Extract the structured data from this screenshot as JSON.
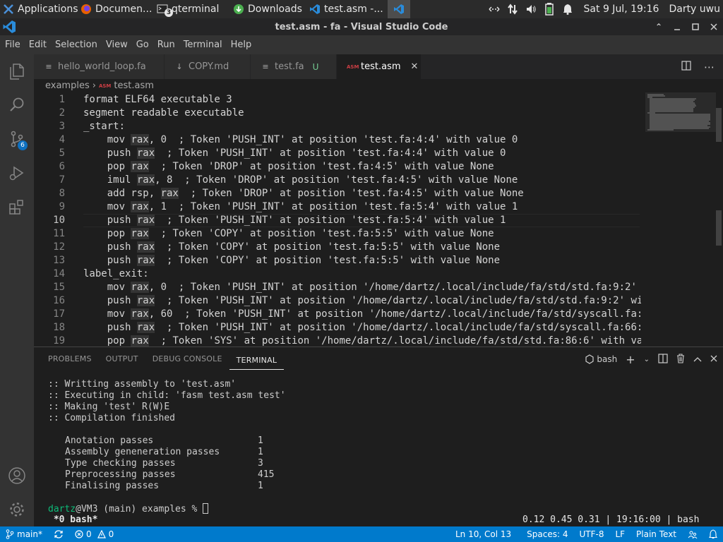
{
  "taskbar": {
    "tasks": [
      {
        "label": "Applications",
        "icon": "xfce-mouse-icon"
      },
      {
        "label": "Documen...",
        "icon": "firefox-icon"
      },
      {
        "label": "qterminal",
        "icon": "terminal-icon",
        "badge": "3"
      },
      {
        "label": "Downloads",
        "icon": "downloads-icon"
      },
      {
        "label": "test.asm -...",
        "icon": "vscode-icon"
      },
      {
        "label": "",
        "icon": "vscode-icon"
      }
    ],
    "datetime": "Sat  9 Jul, 19:16",
    "user": "Darty uwu"
  },
  "window": {
    "title": "test.asm - fa - Visual Studio Code"
  },
  "menu": [
    "File",
    "Edit",
    "Selection",
    "View",
    "Go",
    "Run",
    "Terminal",
    "Help"
  ],
  "activity": {
    "source_control_badge": "6"
  },
  "tabs": [
    {
      "label": "hello_world_loop.fa",
      "icon": "≡",
      "badge": ""
    },
    {
      "label": "COPY.md",
      "icon": "↓",
      "badge": ""
    },
    {
      "label": "test.fa",
      "icon": "≡",
      "badge": "U"
    },
    {
      "label": "test.asm",
      "icon": "ASM",
      "badge": "",
      "close": "✕"
    }
  ],
  "breadcrumb": {
    "folder": "examples",
    "separator": "›",
    "file_icon": "ASM",
    "file": "test.asm"
  },
  "editor": {
    "current_line": 10,
    "lines": [
      {
        "n": "1",
        "segments": [
          [
            "format ELF64 executable 3",
            false
          ]
        ]
      },
      {
        "n": "2",
        "segments": [
          [
            "segment readable executable",
            false
          ]
        ]
      },
      {
        "n": "3",
        "segments": [
          [
            "_start:",
            false
          ]
        ]
      },
      {
        "n": "4",
        "segments": [
          [
            "    mov ",
            false
          ],
          [
            "rax",
            true
          ],
          [
            ", 0  ; Token 'PUSH_INT' at position 'test.fa:4:4' with value 0",
            false
          ]
        ]
      },
      {
        "n": "5",
        "segments": [
          [
            "    push ",
            false
          ],
          [
            "rax",
            true
          ],
          [
            "  ; Token 'PUSH_INT' at position 'test.fa:4:4' with value 0",
            false
          ]
        ]
      },
      {
        "n": "6",
        "segments": [
          [
            "    pop ",
            false
          ],
          [
            "rax",
            true
          ],
          [
            "  ; Token 'DROP' at position 'test.fa:4:5' with value None",
            false
          ]
        ]
      },
      {
        "n": "7",
        "segments": [
          [
            "    imul ",
            false
          ],
          [
            "rax",
            true
          ],
          [
            ", 8  ; Token 'DROP' at position 'test.fa:4:5' with value None",
            false
          ]
        ]
      },
      {
        "n": "8",
        "segments": [
          [
            "    add rsp, ",
            false
          ],
          [
            "rax",
            true
          ],
          [
            "  ; Token 'DROP' at position 'test.fa:4:5' with value None",
            false
          ]
        ]
      },
      {
        "n": "9",
        "segments": [
          [
            "    mov ",
            false
          ],
          [
            "rax",
            true
          ],
          [
            ", 1  ; Token 'PUSH_INT' at position 'test.fa:5:4' with value 1",
            false
          ]
        ]
      },
      {
        "n": "10",
        "segments": [
          [
            "    push ",
            false
          ],
          [
            "rax",
            true
          ],
          [
            "  ; Token 'PUSH_INT' at position 'test.fa:5:4' with value 1",
            false
          ]
        ]
      },
      {
        "n": "11",
        "segments": [
          [
            "    pop ",
            false
          ],
          [
            "rax",
            true
          ],
          [
            "  ; Token 'COPY' at position 'test.fa:5:5' with value None",
            false
          ]
        ]
      },
      {
        "n": "12",
        "segments": [
          [
            "    push ",
            false
          ],
          [
            "rax",
            true
          ],
          [
            "  ; Token 'COPY' at position 'test.fa:5:5' with value None",
            false
          ]
        ]
      },
      {
        "n": "13",
        "segments": [
          [
            "    push ",
            false
          ],
          [
            "rax",
            true
          ],
          [
            "  ; Token 'COPY' at position 'test.fa:5:5' with value None",
            false
          ]
        ]
      },
      {
        "n": "14",
        "segments": [
          [
            "label_exit:",
            false
          ]
        ]
      },
      {
        "n": "15",
        "segments": [
          [
            "    mov ",
            false
          ],
          [
            "rax",
            true
          ],
          [
            ", 0  ; Token 'PUSH_INT' at position '/home/dartz/.local/include/fa/std/std.fa:9:2' w",
            false
          ]
        ]
      },
      {
        "n": "16",
        "segments": [
          [
            "    push ",
            false
          ],
          [
            "rax",
            true
          ],
          [
            "  ; Token 'PUSH_INT' at position '/home/dartz/.local/include/fa/std/std.fa:9:2' wi",
            false
          ]
        ]
      },
      {
        "n": "17",
        "segments": [
          [
            "    mov ",
            false
          ],
          [
            "rax",
            true
          ],
          [
            ", 60  ; Token 'PUSH_INT' at position '/home/dartz/.local/include/fa/std/syscall.fa:",
            false
          ]
        ]
      },
      {
        "n": "18",
        "segments": [
          [
            "    push ",
            false
          ],
          [
            "rax",
            true
          ],
          [
            "  ; Token 'PUSH_INT' at position '/home/dartz/.local/include/fa/std/syscall.fa:66:",
            false
          ]
        ]
      },
      {
        "n": "19",
        "segments": [
          [
            "    pop ",
            false
          ],
          [
            "rax",
            true
          ],
          [
            "  ; Token 'SYS' at position '/home/dartz/.local/include/fa/std/std.fa:86:6' with va",
            false
          ]
        ]
      }
    ]
  },
  "panel": {
    "tabs": [
      "PROBLEMS",
      "OUTPUT",
      "DEBUG CONSOLE",
      "TERMINAL"
    ],
    "active_tab": "TERMINAL",
    "shell": "bash",
    "terminal": {
      "log": [
        ":: Writting assembly to 'test.asm'",
        ":: Executing in child: 'fasm test.asm test'",
        ":: Making 'test' R(W)E",
        ":: Compilation finished"
      ],
      "stats": [
        {
          "label": "Anotation passes",
          "value": "1"
        },
        {
          "label": "Assembly geneneration passes",
          "value": "1"
        },
        {
          "label": "Type checking passes",
          "value": "3"
        },
        {
          "label": "Preprocessing passes",
          "value": "415"
        },
        {
          "label": "Finalising passes",
          "value": "1"
        }
      ],
      "prompt_user": "dartz",
      "prompt_rest": "@VM3 (main) examples % ",
      "tmux_window": " *0 bash*",
      "tmux_status": "0.12 0.45 0.31 | 19:16:00 | bash"
    }
  },
  "status": {
    "branch": "main*",
    "errors": "0",
    "warnings": "0",
    "position": "Ln 10, Col 13",
    "indent": "Spaces: 4",
    "encoding": "UTF-8",
    "eol": "LF",
    "language": "Plain Text"
  },
  "colors": {
    "accent": "#007acc",
    "prompt_user": "#0dbc79",
    "source_control_badge": "#0e70c0"
  }
}
